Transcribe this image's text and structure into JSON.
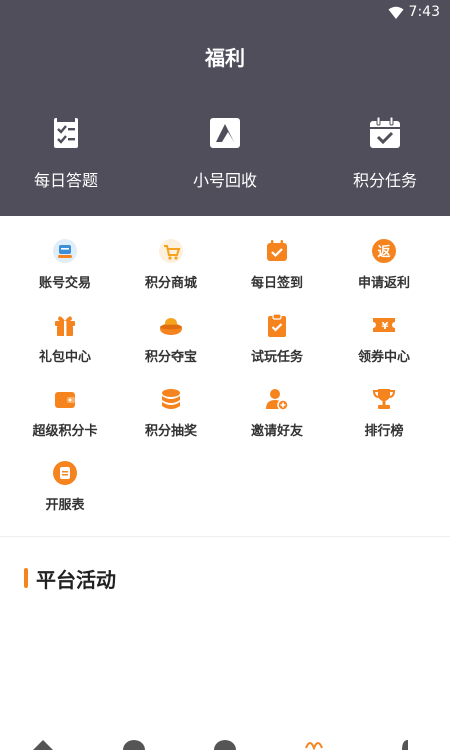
{
  "status": {
    "time": "7:43"
  },
  "header": {
    "title": "福利",
    "features": [
      {
        "label": "每日答题",
        "icon": "daily-quiz-icon"
      },
      {
        "label": "小号回收",
        "icon": "account-recycle-icon"
      },
      {
        "label": "积分任务",
        "icon": "points-task-icon"
      }
    ]
  },
  "grid": {
    "items": [
      {
        "label": "账号交易",
        "icon": "account-trade-icon"
      },
      {
        "label": "积分商城",
        "icon": "points-mall-icon"
      },
      {
        "label": "每日签到",
        "icon": "daily-checkin-icon"
      },
      {
        "label": "申请返利",
        "icon": "rebate-icon"
      },
      {
        "label": "礼包中心",
        "icon": "gift-icon"
      },
      {
        "label": "积分夺宝",
        "icon": "treasure-icon"
      },
      {
        "label": "试玩任务",
        "icon": "trial-task-icon"
      },
      {
        "label": "领券中心",
        "icon": "coupon-icon"
      },
      {
        "label": "超级积分卡",
        "icon": "wallet-card-icon"
      },
      {
        "label": "积分抽奖",
        "icon": "lottery-icon"
      },
      {
        "label": "邀请好友",
        "icon": "invite-friend-icon"
      },
      {
        "label": "排行榜",
        "icon": "trophy-icon"
      },
      {
        "label": "开服表",
        "icon": "server-schedule-icon"
      }
    ]
  },
  "section": {
    "title": "平台活动"
  },
  "colors": {
    "header_bg": "#4f4e5a",
    "accent": "#f5841f"
  }
}
